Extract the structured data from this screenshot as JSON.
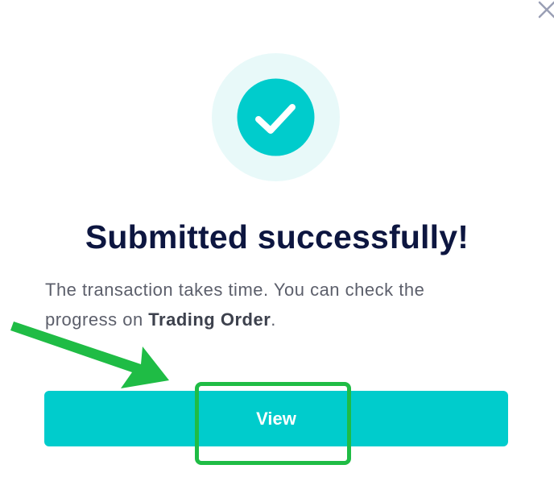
{
  "dialog": {
    "close_icon": "close-icon",
    "status_icon": "check-circle-icon",
    "title": "Submitted successfully!",
    "message_prefix": "The transaction takes time. You can check the progress on ",
    "message_link": "Trading Order",
    "message_suffix": ".",
    "view_label": "View"
  },
  "annotations": {
    "arrow_icon": "arrow-icon",
    "highlight": "highlight-box"
  },
  "colors": {
    "accent": "#00cccc",
    "accent_light": "#e8f9f9",
    "title": "#0d1640",
    "text": "#5c5f6b",
    "annotation": "#1fbc45",
    "close": "#9a9fb5"
  }
}
